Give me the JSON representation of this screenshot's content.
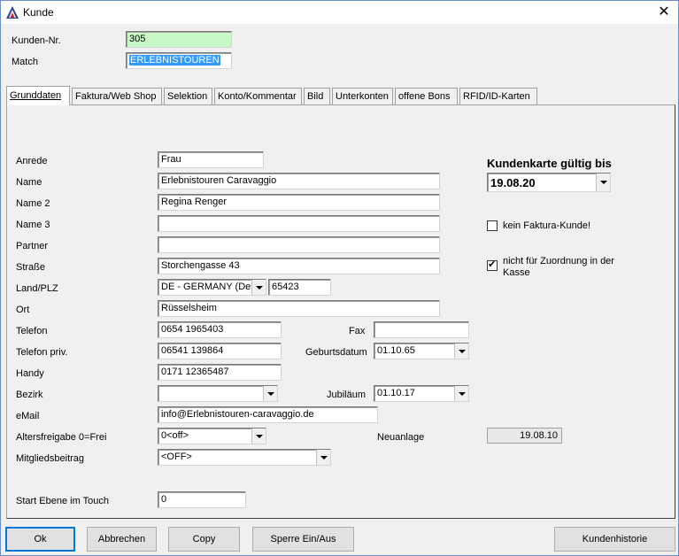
{
  "window": {
    "title": "Kunde",
    "close_glyph": "✕"
  },
  "header": {
    "customer_no_label": "Kunden-Nr.",
    "customer_no_value": "305",
    "match_label": "Match",
    "match_value": "ERLEBNISTOUREN"
  },
  "tabs": [
    {
      "label": "Grunddaten",
      "active": true
    },
    {
      "label": "Faktura/Web Shop"
    },
    {
      "label": "Selektion"
    },
    {
      "label": "Konto/Kommentar"
    },
    {
      "label": "Bild"
    },
    {
      "label": "Unterkonten"
    },
    {
      "label": "offene Bons"
    },
    {
      "label": "RFID/ID-Karten"
    }
  ],
  "form": {
    "anrede": {
      "label": "Anrede",
      "value": "Frau"
    },
    "name": {
      "label": "Name",
      "value": "Erlebnistouren Caravaggio"
    },
    "name2": {
      "label": "Name 2",
      "value": "Regina Renger"
    },
    "name3": {
      "label": "Name 3",
      "value": ""
    },
    "partner": {
      "label": "Partner",
      "value": ""
    },
    "strasse": {
      "label": "Straße",
      "value": "Storchengasse 43"
    },
    "land_plz": {
      "label": "Land/PLZ",
      "country": "DE - GERMANY (Deu",
      "plz": "65423"
    },
    "ort": {
      "label": "Ort",
      "value": "Rüsselsheim"
    },
    "telefon": {
      "label": "Telefon",
      "value": "0654 1965403"
    },
    "fax": {
      "label": "Fax",
      "value": ""
    },
    "telefon_priv": {
      "label": "Telefon priv.",
      "value": "06541 139864"
    },
    "geburtsdatum": {
      "label": "Geburtsdatum",
      "value": "01.10.65"
    },
    "handy": {
      "label": "Handy",
      "value": "0171 12365487"
    },
    "bezirk": {
      "label": "Bezirk",
      "value": ""
    },
    "jubilaeum": {
      "label": "Jubiläum",
      "value": "01.10.17"
    },
    "email": {
      "label": "eMail",
      "value": "info@Erlebnistouren-caravaggio.de"
    },
    "altersfreigabe": {
      "label": "Altersfreigabe 0=Frei",
      "value": "0<off>"
    },
    "neuanlage": {
      "label": "Neuanlage",
      "value": "19.08.10"
    },
    "mitgliedsbeitrag": {
      "label": "Mitgliedsbeitrag",
      "value": "<OFF>"
    },
    "start_ebene": {
      "label": "Start Ebene im Touch",
      "value": "0"
    }
  },
  "card": {
    "title": "Kundenkarte gültig bis",
    "value": "19.08.20"
  },
  "options": {
    "kein_faktura": {
      "label": "kein Faktura-Kunde!",
      "checked": false
    },
    "nicht_zuordnung": {
      "label_line1": "nicht für Zuordnung in der",
      "label_line2": "Kasse",
      "checked": true
    }
  },
  "buttons": {
    "ok": "Ok",
    "abbrechen": "Abbrechen",
    "copy": "Copy",
    "sperre": "Sperre Ein/Aus",
    "historie": "Kundenhistorie"
  }
}
